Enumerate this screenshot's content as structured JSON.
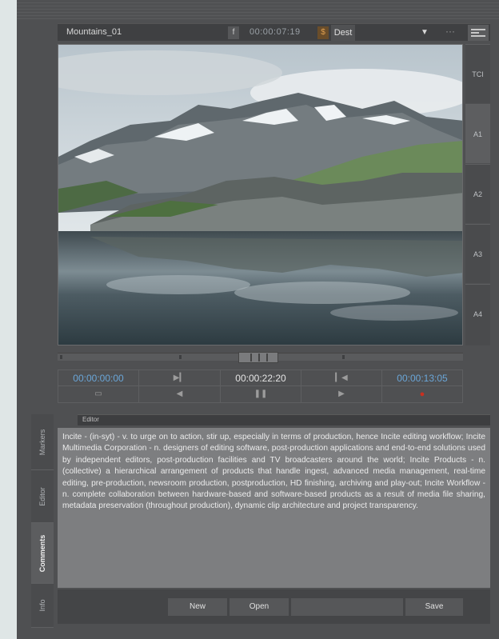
{
  "title_bar": {
    "clip_name": "Mountains_01",
    "f_label": "f",
    "timecode": "00:00:07:19",
    "s_label": "$",
    "dest_label": "Dest",
    "dropdown_glyph": "▼",
    "more_glyph": "···"
  },
  "tracks": [
    "TCI",
    "A1",
    "A2",
    "A3",
    "A4"
  ],
  "active_track": "A1",
  "transport": {
    "in_tc": "00:00:00:00",
    "current_tc": "00:00:22:20",
    "out_tc": "00:00:13:05",
    "mark_in_icon": "mark-in-icon",
    "mark_out_icon": "mark-out-icon",
    "monitor_icon": "monitor-icon",
    "prev_icon": "step-back-icon",
    "pause_icon": "pause-icon",
    "next_icon": "step-forward-icon",
    "record_icon": "record-icon"
  },
  "side_tabs": [
    "Markers",
    "Editor",
    "Comments",
    "Info"
  ],
  "active_side_tab": "Comments",
  "editor": {
    "header": "Editor",
    "text": "Incite - (in-syt) - v. to urge on to action, stir up, especially in terms of production, hence Incite editing workflow; Incite Multimedia Corporation - n. designers of editing software, post-production applications and end-to-end solutions used by independent editors, post-production facilities and TV broadcasters around the world; Incite Products - n. (collective) a hierarchical arrangement of products that handle ingest, advanced media management, real-time editing, pre-production, newsroom production, postproduction, HD finishing, archiving and play-out; Incite Workflow - n. complete collaboration between hardware-based and software-based products as a result of media file sharing, metadata preservation (throughout production), dynamic clip architecture and project transparency."
  },
  "buttons": {
    "new": "New",
    "open": "Open",
    "blank": "",
    "save": "Save"
  },
  "colors": {
    "timecode_blue": "#6aa6d8",
    "record_red": "#c83020",
    "panel_bg": "#4f5052"
  }
}
